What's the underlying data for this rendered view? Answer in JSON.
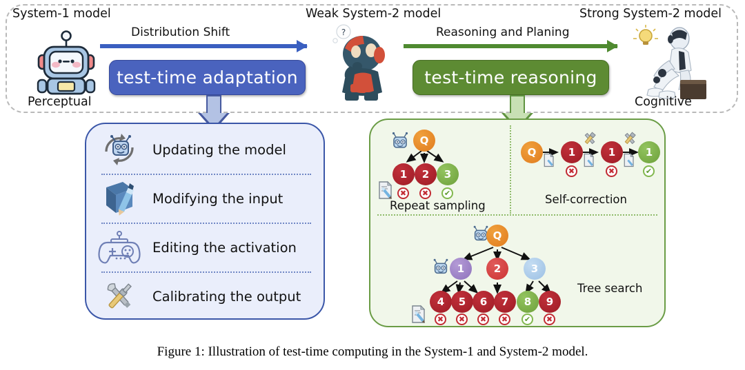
{
  "figure": {
    "caption": "Figure 1: Illustration of test-time computing in the System-1 and System-2 model."
  },
  "banner": {
    "stage_labels": {
      "system1": "System-1 model",
      "weak_system2": "Weak System-2 model",
      "strong_system2": "Strong System-2 model"
    },
    "role_labels": {
      "left": "Perceptual",
      "right": "Cognitive"
    },
    "arrows": [
      {
        "label": "Distribution Shift",
        "color": "#3a5fc0"
      },
      {
        "label": "Reasoning and Planing",
        "color": "#4f8a30"
      }
    ],
    "pills": [
      {
        "label": "test-time adaptation",
        "color": "#4a63be"
      },
      {
        "label": "test-time reasoning",
        "color": "#5d8b33"
      }
    ]
  },
  "left_panel": {
    "accent": "#3a56a8",
    "background": "#eaeefb",
    "methods": [
      {
        "icon": "refresh-robot-icon",
        "label": "Updating the model"
      },
      {
        "icon": "book-pencil-icon",
        "label": "Modifying the input"
      },
      {
        "icon": "gamepad-icon",
        "label": "Editing the activation"
      },
      {
        "icon": "wrench-screwdriver-icon",
        "label": "Calibrating the output"
      }
    ]
  },
  "right_panel": {
    "accent": "#6a9c45",
    "background": "#f1f7ea",
    "sections": [
      {
        "title": "Repeat sampling"
      },
      {
        "title": "Self-correction"
      },
      {
        "title": "Tree search"
      }
    ],
    "repeat_sampling": {
      "root": "Q",
      "children": [
        {
          "label": "1",
          "color": "#a5222c",
          "verdict": "x"
        },
        {
          "label": "2",
          "color": "#a5222c",
          "verdict": "x"
        },
        {
          "label": "3",
          "color": "#76a842",
          "verdict": "ok"
        }
      ]
    },
    "self_correction": {
      "root": "Q",
      "steps": [
        {
          "label": "1",
          "color": "#a5222c",
          "verdict": "x"
        },
        {
          "label": "1",
          "color": "#a5222c",
          "verdict": "x"
        },
        {
          "label": "1",
          "color": "#76a842",
          "verdict": "ok"
        }
      ]
    },
    "tree_search": {
      "root": "Q",
      "level1": [
        {
          "label": "1",
          "color": "#9b7fc4"
        },
        {
          "label": "2",
          "color": "#d44a4a"
        },
        {
          "label": "3",
          "color": "#a8c8e8"
        }
      ],
      "leaves": [
        {
          "label": "4",
          "color": "#a5222c",
          "verdict": "x"
        },
        {
          "label": "5",
          "color": "#a5222c",
          "verdict": "x"
        },
        {
          "label": "6",
          "color": "#a5222c",
          "verdict": "x"
        },
        {
          "label": "7",
          "color": "#a5222c",
          "verdict": "x"
        },
        {
          "label": "8",
          "color": "#76a842",
          "verdict": "ok"
        },
        {
          "label": "9",
          "color": "#a5222c",
          "verdict": "x"
        }
      ]
    },
    "marks": {
      "x": "✖",
      "ok": "✔"
    }
  }
}
